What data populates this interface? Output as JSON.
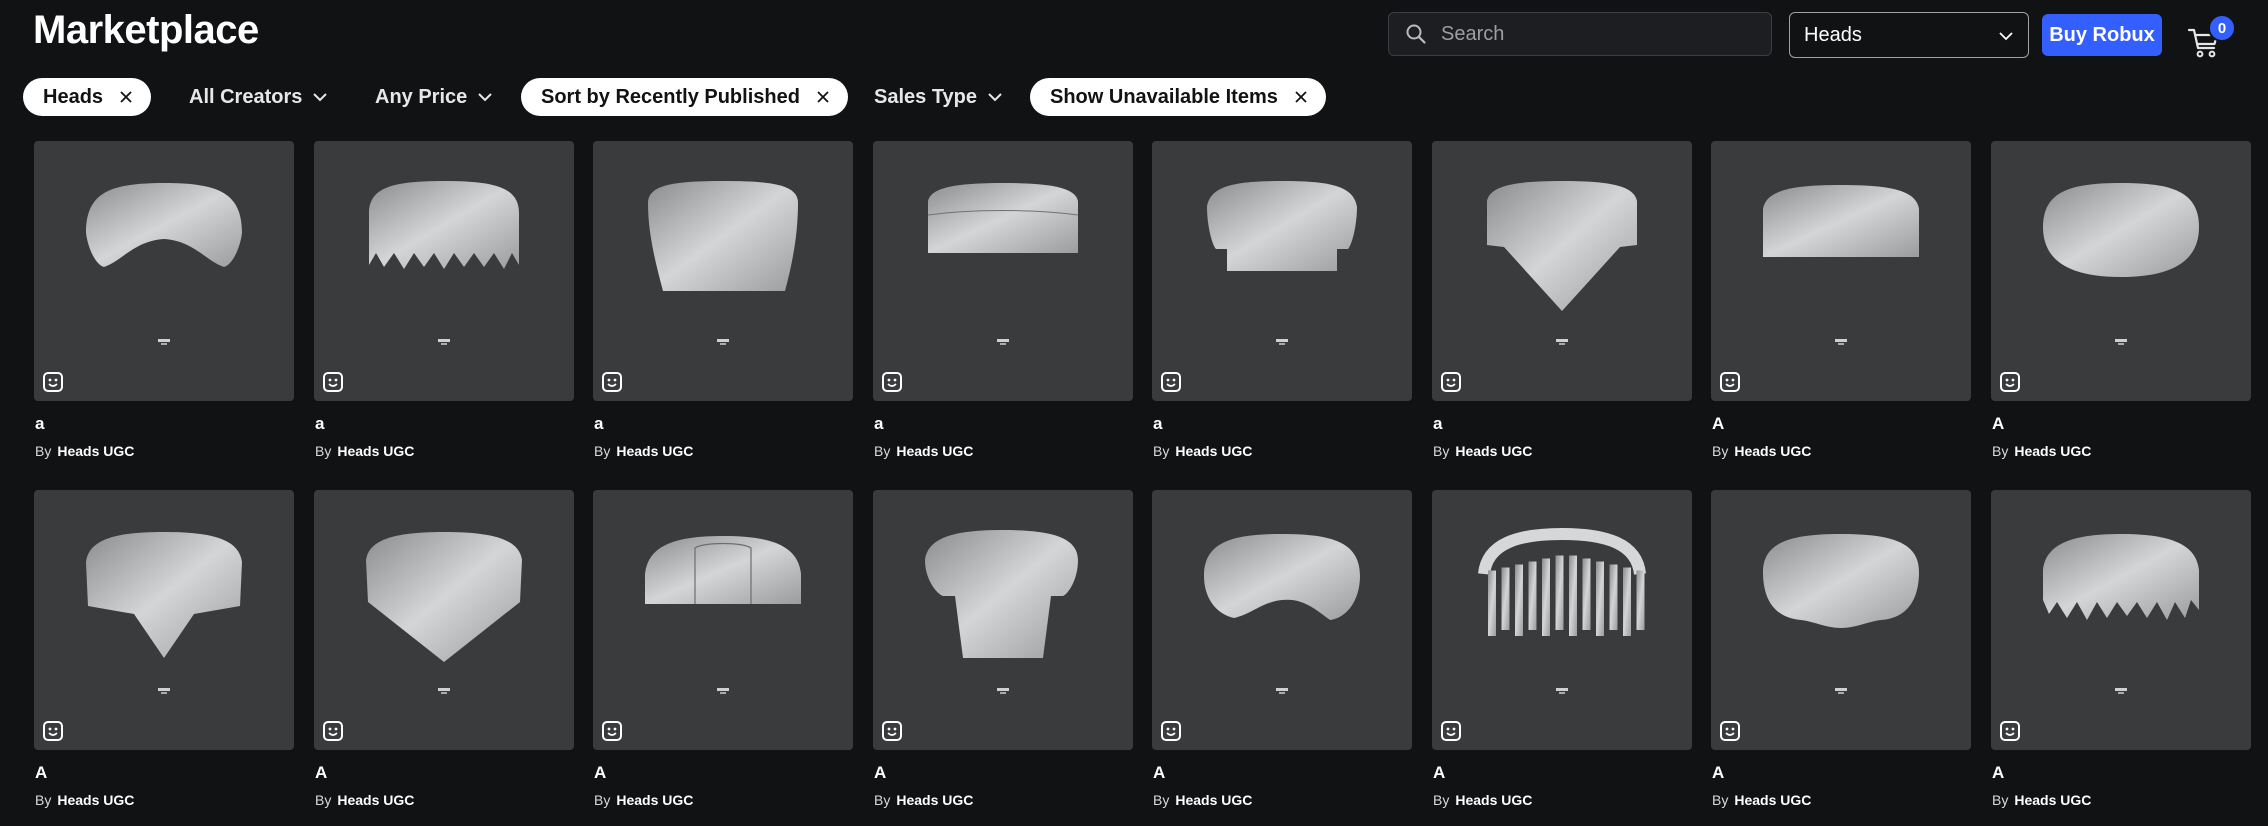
{
  "header": {
    "title": "Marketplace",
    "search_placeholder": "Search",
    "category_value": "Heads",
    "buy_robux_label": "Buy Robux",
    "cart_count": "0",
    "accent_color": "#335fff"
  },
  "filters": [
    {
      "label": "Heads",
      "active": true,
      "control": "x"
    },
    {
      "label": "All Creators",
      "active": false,
      "control": "chevron"
    },
    {
      "label": "Any Price",
      "active": false,
      "control": "chevron"
    },
    {
      "label": "Sort by Recently Published",
      "active": true,
      "control": "x"
    },
    {
      "label": "Sales Type",
      "active": false,
      "control": "chevron"
    },
    {
      "label": "Show Unavailable Items",
      "active": true,
      "control": "x"
    }
  ],
  "by_prefix": "By",
  "items": [
    {
      "name": "a",
      "creator": "Heads UGC",
      "shape": "ring"
    },
    {
      "name": "a",
      "creator": "Heads UGC",
      "shape": "jagged"
    },
    {
      "name": "a",
      "creator": "Heads UGC",
      "shape": "tall"
    },
    {
      "name": "a",
      "creator": "Heads UGC",
      "shape": "band"
    },
    {
      "name": "a",
      "creator": "Heads UGC",
      "shape": "mushroom"
    },
    {
      "name": "a",
      "creator": "Heads UGC",
      "shape": "spike"
    },
    {
      "name": "A",
      "creator": "Heads UGC",
      "shape": "dome"
    },
    {
      "name": "A",
      "creator": "Heads UGC",
      "shape": "blob"
    },
    {
      "name": "A",
      "creator": "Heads UGC",
      "shape": "cone"
    },
    {
      "name": "A",
      "creator": "Heads UGC",
      "shape": "diamond"
    },
    {
      "name": "A",
      "creator": "Heads UGC",
      "shape": "helmet"
    },
    {
      "name": "A",
      "creator": "Heads UGC",
      "shape": "pedestal"
    },
    {
      "name": "A",
      "creator": "Heads UGC",
      "shape": "saddle"
    },
    {
      "name": "A",
      "creator": "Heads UGC",
      "shape": "cage"
    },
    {
      "name": "A",
      "creator": "Heads UGC",
      "shape": "pillow"
    },
    {
      "name": "A",
      "creator": "Heads UGC",
      "shape": "fringe"
    }
  ]
}
